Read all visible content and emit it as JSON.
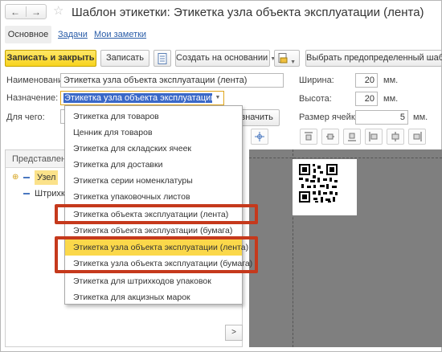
{
  "window": {
    "title": "Шаблон этикетки: Этикетка узла объекта эксплуатации (лента)",
    "back_icon": "←",
    "forward_icon": "→",
    "favorite_icon": "☆"
  },
  "tabs": {
    "main": "Основное",
    "tasks": "Задачи",
    "notes": "Мои заметки"
  },
  "toolbar": {
    "save_close": "Записать и закрыть",
    "save": "Записать",
    "create_based_on": "Создать на основании",
    "choose_template": "Выбрать предопределенный шаблон"
  },
  "form": {
    "name_label": "Наименование:",
    "name_value": "Этикетка узла объекта эксплуатации (лента)",
    "purpose_label": "Назначение:",
    "purpose_value": "Этикетка узла объекта эксплуатации (лента)",
    "for_what_label": "Для чего:",
    "assign_button_fragment": "значить",
    "width_label": "Ширина:",
    "width_value": "20",
    "width_unit": "мм.",
    "height_label": "Высота:",
    "height_value": "20",
    "height_unit": "мм.",
    "cell_label": "Размер ячейки:",
    "cell_value": "5",
    "cell_unit": "мм."
  },
  "tree": {
    "header": "Представление",
    "rows": [
      "Узел",
      "Штрихкод"
    ]
  },
  "dropdown": {
    "selected_index": 8,
    "items": [
      "Этикетка для товаров",
      "Ценник для товаров",
      "Этикетка для складских ячеек",
      "Этикетка для доставки",
      "Этикетка серии номенклатуры",
      "Этикетка упаковочных листов",
      "Этикетка объекта эксплуатации (лента)",
      "Этикетка объекта эксплуатации (бумага)",
      "Этикетка узла объекта эксплуатации (лента)",
      "Этикетка узла объекта эксплуатации (бумага)",
      "Этикетка для штрихкодов упаковок",
      "Этикетка для акцизных марок"
    ]
  },
  "scroll_right": ">",
  "colors": {
    "primary_button": "#f7d41f",
    "highlight": "#c5391c",
    "selection": "#fbd84a",
    "link": "#2a5da8",
    "canvas": "#7f7f7f"
  }
}
